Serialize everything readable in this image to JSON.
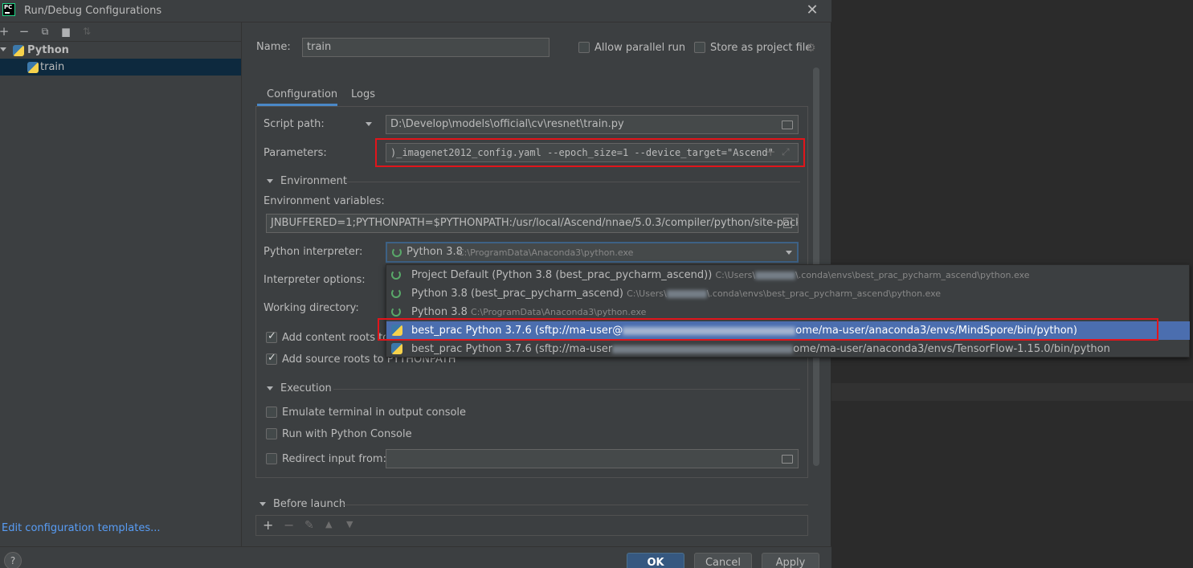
{
  "window": {
    "title": "Run/Debug Configurations",
    "app_icon": "pycharm-logo",
    "app_icon_text": "PC"
  },
  "left_panel": {
    "toolbar_icons": [
      "add-icon",
      "remove-icon",
      "copy-icon",
      "folder-icon",
      "sort-icon"
    ],
    "tree": {
      "group_label": "Python",
      "child_label": "train"
    },
    "edit_templates_link": "Edit configuration templates..."
  },
  "form": {
    "name_label": "Name:",
    "name_value": "train",
    "allow_parallel_label": "Allow parallel run",
    "store_as_project_label": "Store as project file",
    "tabs": [
      "Configuration",
      "Logs"
    ],
    "script_path_label": "Script path:",
    "script_path_value": "D:\\Develop\\models\\official\\cv\\resnet\\train.py",
    "parameters_label": "Parameters:",
    "parameters_value": ")_imagenet2012_config.yaml --epoch_size=1 --device_target=\"Ascend\"",
    "environment_section": "Environment",
    "env_vars_label": "Environment variables:",
    "env_vars_value": "JNBUFFERED=1;PYTHONPATH=$PYTHONPATH:/usr/local/Ascend/nnae/5.0.3/compiler/python/site-packages",
    "interpreter_label": "Python interpreter:",
    "interpreter_selected_name": "Python 3.8",
    "interpreter_selected_path": "C:\\ProgramData\\Anaconda3\\python.exe",
    "interpreter_options_label": "Interpreter options:",
    "working_dir_label": "Working directory:",
    "add_content_roots_label": "Add content roots to",
    "add_source_roots_label": "Add source roots to PYTHONPATH",
    "execution_section": "Execution",
    "emulate_terminal_label": "Emulate terminal in output console",
    "run_with_console_label": "Run with Python Console",
    "redirect_input_label": "Redirect input from:",
    "before_launch_section": "Before launch"
  },
  "interpreter_dropdown": {
    "items": [
      {
        "name": "Project Default (Python 3.8 (best_prac_pycharm_ascend))",
        "path_prefix": "C:\\Users\\",
        "path_suffix": "\\.conda\\envs\\best_prac_pycharm_ascend\\python.exe",
        "icon": "spinner-icon"
      },
      {
        "name": "Python 3.8 (best_prac_pycharm_ascend)",
        "path_prefix": "C:\\Users\\",
        "path_suffix": "\\.conda\\envs\\best_prac_pycharm_ascend\\python.exe",
        "icon": "spinner-icon"
      },
      {
        "name": "Python 3.8",
        "path_prefix": "C:\\ProgramData\\Anaconda3\\python.exe",
        "path_suffix": "",
        "icon": "spinner-icon"
      },
      {
        "name_prefix": "best_prac Python 3.7.6 (sftp://ma-user@",
        "name_suffix": "ome/ma-user/anaconda3/envs/MindSpore/bin/python)",
        "icon": "python-icon",
        "selected": true
      },
      {
        "name_prefix": "best_prac Python 3.7.6 (sftp://ma-user",
        "name_suffix": "ome/ma-user/anaconda3/envs/TensorFlow-1.15.0/bin/python",
        "icon": "python-icon"
      }
    ]
  },
  "buttons": {
    "help": "?",
    "ok": "OK",
    "cancel": "Cancel",
    "apply": "Apply"
  },
  "colors": {
    "highlight": "#4b6eaf",
    "annotation_red": "#e1151b",
    "link": "#589df6",
    "tab_underline": "#4a88c7"
  }
}
